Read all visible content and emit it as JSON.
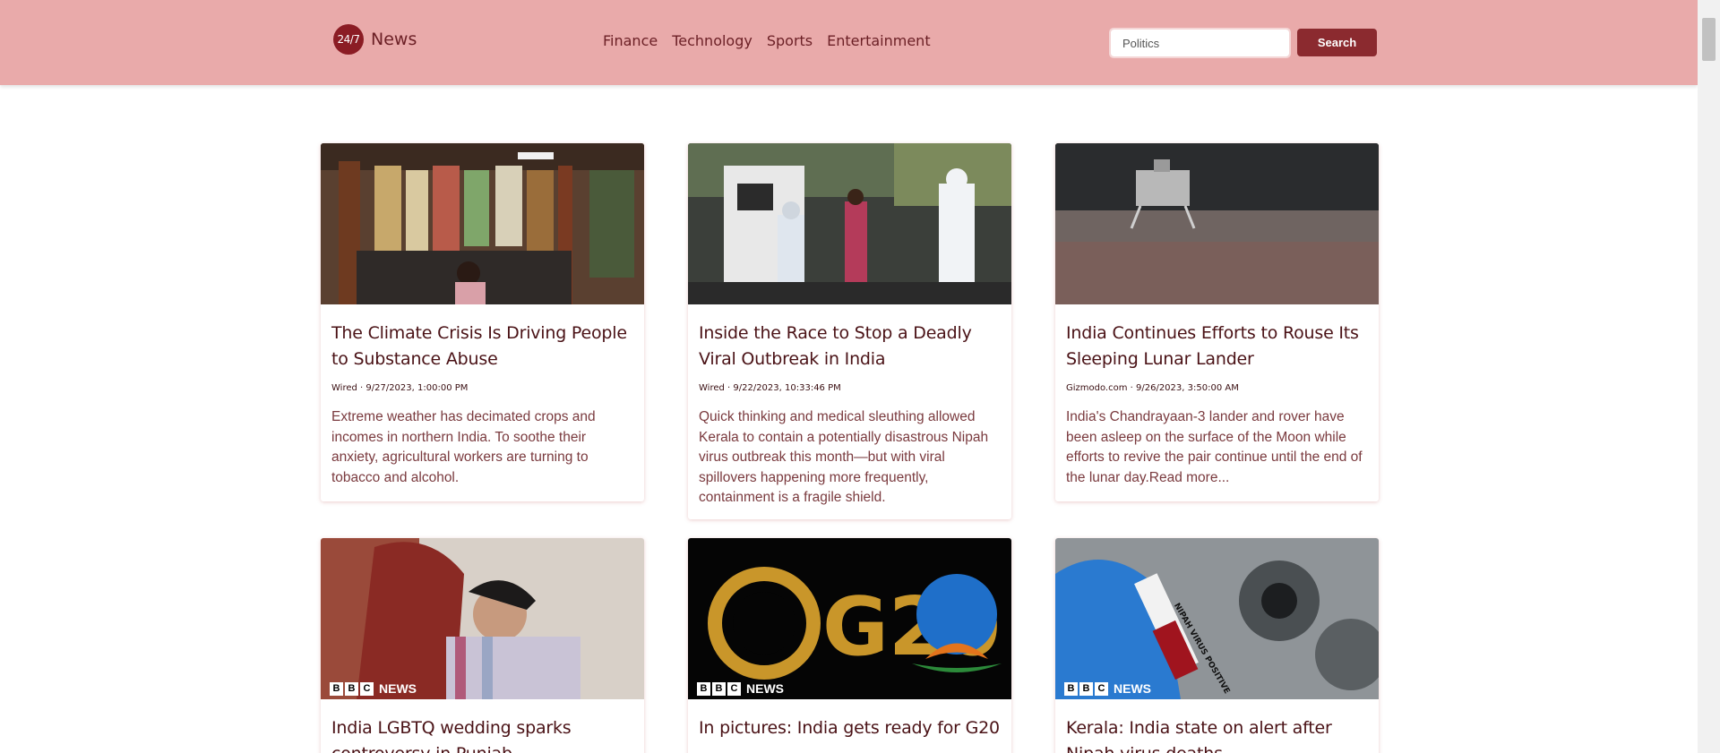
{
  "header": {
    "logo_badge": "24/7",
    "logo_text": "News",
    "nav": [
      "Finance",
      "Technology",
      "Sports",
      "Entertainment"
    ],
    "search_value": "Politics",
    "search_button": "Search"
  },
  "articles": [
    {
      "title": "The Climate Crisis Is Driving People to Substance Abuse",
      "meta": "Wired · 9/27/2023, 1:00:00 PM",
      "description": "Extreme weather has decimated crops and incomes in northern India. To soothe their anxiety, agricultural workers are turning to tobacco and alcohol."
    },
    {
      "title": "Inside the Race to Stop a Deadly Viral Outbreak in India",
      "meta": "Wired · 9/22/2023, 10:33:46 PM",
      "description": "Quick thinking and medical sleuthing allowed Kerala to contain a potentially disastrous Nipah virus outbreak this month—but with viral spillovers happening more frequently, containment is a fragile shield."
    },
    {
      "title": "India Continues Efforts to Rouse Its Sleeping Lunar Lander",
      "meta": "Gizmodo.com · 9/26/2023, 3:50:00 AM",
      "description": "India's Chandrayaan-3 lander and rover have been asleep on the surface of the Moon while efforts to revive the pair continue until the end of the lunar day.Read more..."
    },
    {
      "title": "India LGBTQ wedding sparks controversy in Punjab",
      "image_overlay": [
        "B",
        "B",
        "C",
        "NEWS"
      ]
    },
    {
      "title": "In pictures: India gets ready for G20",
      "image_overlay": [
        "B",
        "B",
        "C",
        "NEWS"
      ],
      "image_text": "G20"
    },
    {
      "title": "Kerala: India state on alert after Nipah virus deaths",
      "image_overlay": [
        "B",
        "B",
        "C",
        "NEWS"
      ],
      "image_text": "NIPAH VIRUS POSITIVE"
    }
  ]
}
